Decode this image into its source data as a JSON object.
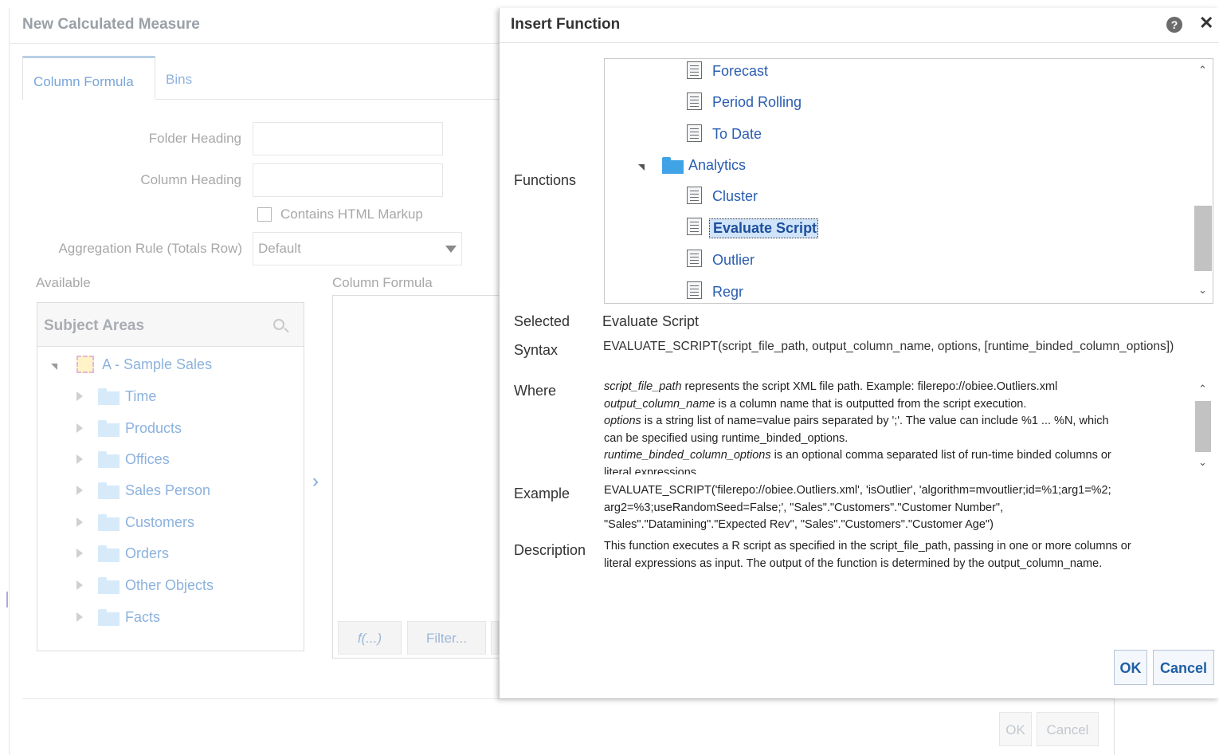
{
  "bg_dialog": {
    "title": "New Calculated Measure",
    "tabs": [
      "Column Formula",
      "Bins"
    ],
    "folder_heading_label": "Folder Heading",
    "column_heading_label": "Column Heading",
    "contains_html_label": "Contains HTML Markup",
    "aggregation_label": "Aggregation Rule (Totals Row)",
    "aggregation_value": "Default",
    "available_label": "Available",
    "column_formula_label": "Column Formula",
    "subject_areas_title": "Subject Areas",
    "subject_area_root": "A - Sample Sales",
    "subject_area_items": [
      "Time",
      "Products",
      "Offices",
      "Sales Person",
      "Customers",
      "Orders",
      "Other Objects",
      "Facts"
    ],
    "buttons": [
      "f(...)",
      "Filter..."
    ],
    "ok_label": "OK",
    "cancel_label": "Cancel"
  },
  "insert_function": {
    "title": "Insert Function",
    "functions_label": "Functions",
    "tree_items": [
      "Forecast",
      "Period Rolling",
      "To Date",
      "Analytics",
      "Cluster",
      "Evaluate Script",
      "Outlier",
      "Regr"
    ],
    "selected_label": "Selected",
    "selected_value": "Evaluate Script",
    "syntax_label": "Syntax",
    "syntax_value": "EVALUATE_SCRIPT(script_file_path, output_column_name, options, [runtime_binded_column_options])",
    "where_label": "Where",
    "where_lines": [
      {
        "term": "script_file_path",
        "text": " represents the script XML file path. Example: filerepo://obiee.Outliers.xml"
      },
      {
        "term": "output_column_name",
        "text": " is a column name that is outputted from the script execution."
      },
      {
        "term": "options",
        "text": " is a string list of name=value pairs separated by ';'. The value can include %1 ... %N, which"
      },
      {
        "term": "",
        "text": "can be specified using runtime_binded_options."
      },
      {
        "term": "runtime_binded_column_options",
        "text": " is an optional comma separated list of run-time binded columns or"
      },
      {
        "term": "",
        "text": "literal expressions"
      }
    ],
    "example_label": "Example",
    "example_lines": [
      "EVALUATE_SCRIPT('filerepo://obiee.Outliers.xml', 'isOutlier', 'algorithm=mvoutlier;id=%1;arg1=%2;",
      "arg2=%3;useRandomSeed=False;', \"Sales\".\"Customers\".\"Customer Number\",",
      "\"Sales\".\"Datamining\".\"Expected Rev\", \"Sales\".\"Customers\".\"Customer Age\")"
    ],
    "description_label": "Description",
    "description_lines": [
      "This function executes a R script as specified in the script_file_path, passing in one or more columns or",
      "literal expressions as input. The output of the function is determined by the output_column_name."
    ],
    "ok_label": "OK",
    "cancel_label": "Cancel",
    "icons": {
      "help": "help-icon",
      "close": "close-icon"
    }
  },
  "colors": {
    "link": "#2a5db0",
    "muted_link": "#8cb2de",
    "folder": "#3fa3e6",
    "selection": "#cfe3f9"
  }
}
